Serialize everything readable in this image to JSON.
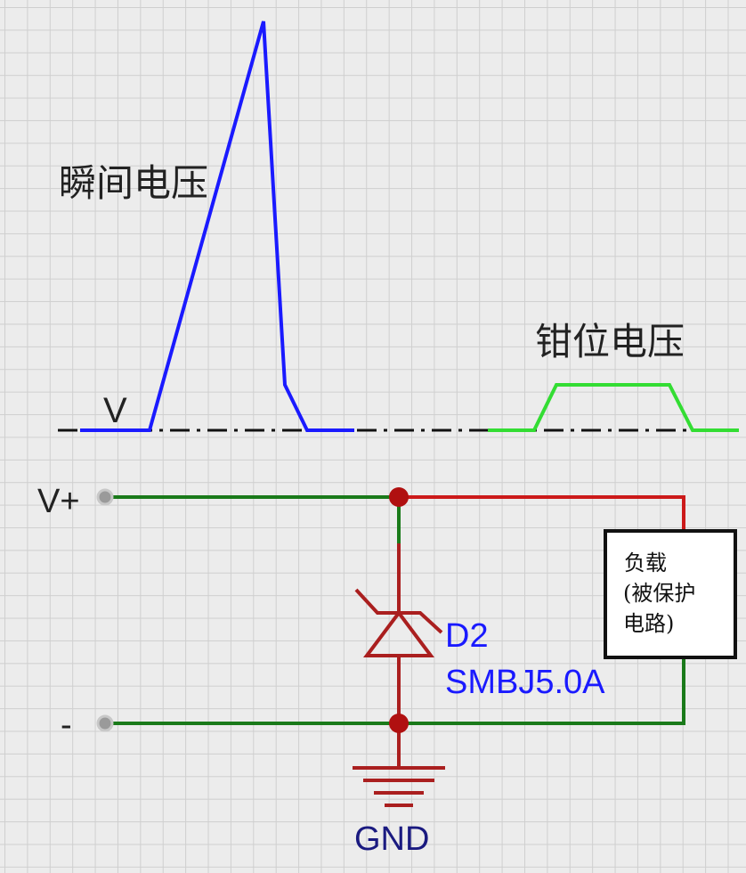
{
  "labels": {
    "transient_voltage": "瞬间电压",
    "clamp_voltage": "钳位电压",
    "baseline_v": "V",
    "terminal_pos": "V+",
    "terminal_neg": "-",
    "diode_ref": "D2",
    "diode_part": "SMBJ5.0A",
    "ground": "GND",
    "load_line1": "负载",
    "load_line2": "(被保护",
    "load_line3": "电路)"
  },
  "colors": {
    "grid": "#cfcfcf",
    "background": "#ececec",
    "transient_trace": "#1a1aff",
    "clamp_trace": "#33dd33",
    "wire_green": "#1a7a1a",
    "wire_red": "#cc1a1a",
    "junction": "#b01010",
    "component_outline": "#aa1f1f",
    "text_blue": "#1a1aff",
    "text_navy": "#1a1a80",
    "text_black": "#111111"
  }
}
